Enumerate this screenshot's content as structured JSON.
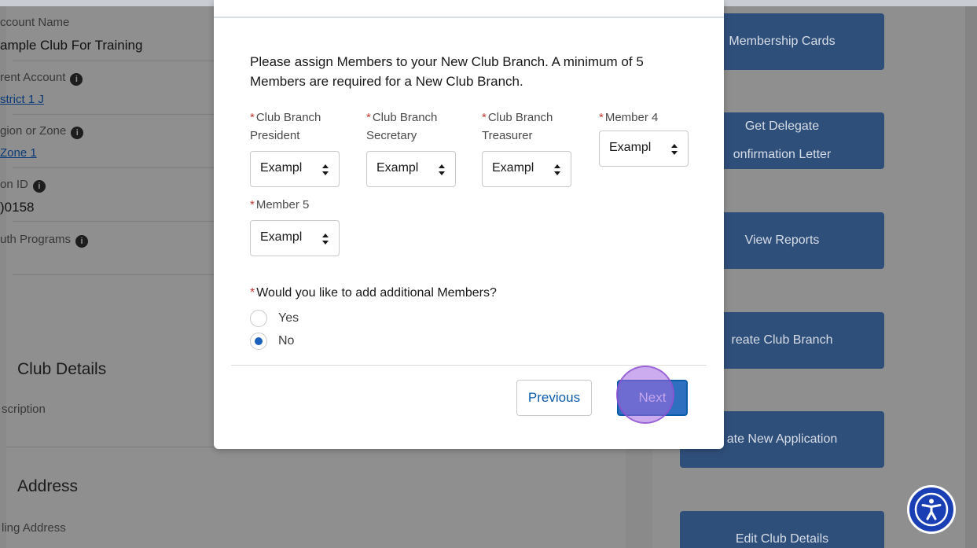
{
  "background": {
    "fields": [
      {
        "label": "ccount Name",
        "value": "ample Club For Training"
      },
      {
        "label": "rent Account",
        "link": "strict 1 J"
      },
      {
        "label": "gion or Zone",
        "link": "Zone 1"
      },
      {
        "label": "on ID",
        "value": ")0158"
      },
      {
        "label": "uth Programs"
      }
    ],
    "sections": [
      {
        "title": "Club Details",
        "sub": "scription"
      },
      {
        "title": "Address",
        "sub": "ling Address"
      }
    ],
    "info_icon_glyph": "i",
    "side_buttons": [
      {
        "line1": "Membership Cards"
      },
      {
        "line1": "Get Delegate",
        "line2": "onfirmation Letter"
      },
      {
        "line1": "View Reports"
      },
      {
        "line1": "reate Club Branch"
      },
      {
        "line1": "ate New Application"
      },
      {
        "line1": "Edit Club Details"
      }
    ]
  },
  "modal": {
    "instructions": "Please assign Members to your New Club Branch. A minimum of 5 Members are required for a New Club Branch.",
    "required_marker": "*",
    "selects": [
      {
        "label": "Club Branch President",
        "value": "Exampl"
      },
      {
        "label": "Club Branch Secretary",
        "value": "Exampl"
      },
      {
        "label": "Club Branch Treasurer",
        "value": "Exampl"
      },
      {
        "label": "Member 4",
        "value": "Exampl"
      },
      {
        "label": "Member 5",
        "value": "Exampl"
      }
    ],
    "question": "Would you like to add additional Members?",
    "options": [
      {
        "label": "Yes",
        "checked": false
      },
      {
        "label": "No",
        "checked": true
      }
    ],
    "previous_label": "Previous",
    "next_label": "Next"
  },
  "colors": {
    "accent": "#0b5cab",
    "required": "#c23934",
    "click_highlight": "#a367e0"
  }
}
